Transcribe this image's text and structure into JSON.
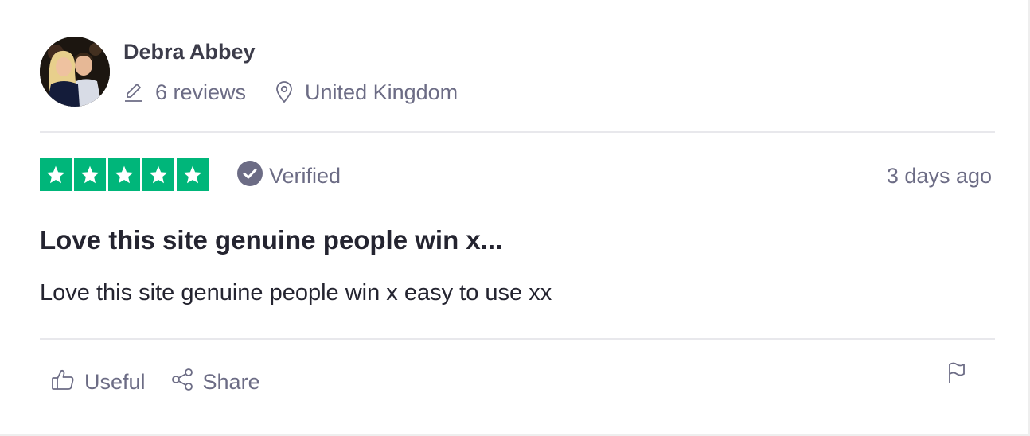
{
  "reviewer": {
    "name": "Debra Abbey",
    "reviews_count": "6 reviews",
    "location": "United Kingdom"
  },
  "review": {
    "rating": 5,
    "max_rating": 5,
    "verified_label": "Verified",
    "date": "3 days ago",
    "title": "Love this site genuine people win x...",
    "body": "Love this site genuine people win x easy to use xx"
  },
  "actions": {
    "useful_label": "Useful",
    "share_label": "Share"
  },
  "icons": {
    "reviews": "pencil-icon",
    "location": "map-pin-icon",
    "verified": "check-circle-icon",
    "useful": "thumbs-up-icon",
    "share": "share-icon",
    "report": "flag-icon"
  },
  "colors": {
    "star_green": "#00b67a",
    "muted_text": "#6c6c85",
    "heading_text": "#242430"
  }
}
